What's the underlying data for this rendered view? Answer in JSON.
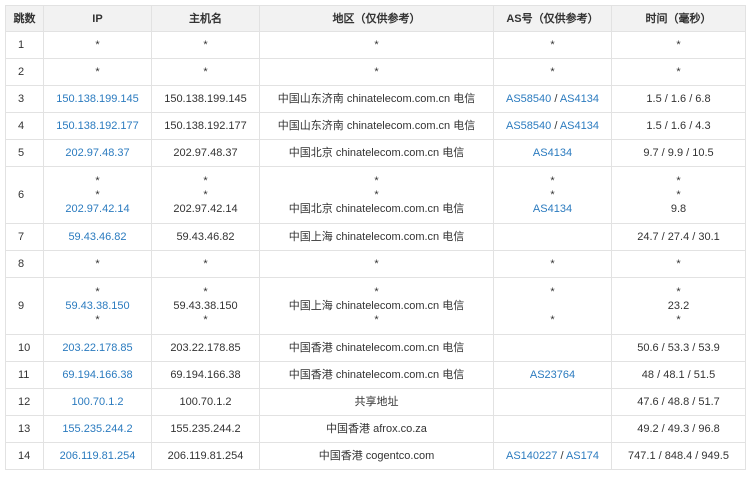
{
  "headers": [
    "跳数",
    "IP",
    "主机名",
    "地区（仅供参考）",
    "AS号（仅供参考）",
    "时间（毫秒）"
  ],
  "rows": [
    {
      "hop": "1",
      "ip": [
        "*"
      ],
      "host": [
        "*"
      ],
      "region": [
        "*"
      ],
      "as": [
        [
          "*"
        ]
      ],
      "time": [
        "*"
      ]
    },
    {
      "hop": "2",
      "ip": [
        "*"
      ],
      "host": [
        "*"
      ],
      "region": [
        "*"
      ],
      "as": [
        [
          "*"
        ]
      ],
      "time": [
        "*"
      ]
    },
    {
      "hop": "3",
      "ip": [
        "150.138.199.145"
      ],
      "host": [
        "150.138.199.145"
      ],
      "region": [
        "中国山东济南 chinatelecom.com.cn 电信"
      ],
      "as": [
        [
          "AS58540",
          "AS4134"
        ]
      ],
      "time": [
        "1.5 / 1.6 / 6.8"
      ]
    },
    {
      "hop": "4",
      "ip": [
        "150.138.192.177"
      ],
      "host": [
        "150.138.192.177"
      ],
      "region": [
        "中国山东济南 chinatelecom.com.cn 电信"
      ],
      "as": [
        [
          "AS58540",
          "AS4134"
        ]
      ],
      "time": [
        "1.5 / 1.6 / 4.3"
      ]
    },
    {
      "hop": "5",
      "ip": [
        "202.97.48.37"
      ],
      "host": [
        "202.97.48.37"
      ],
      "region": [
        "中国北京 chinatelecom.com.cn 电信"
      ],
      "as": [
        [
          "AS4134"
        ]
      ],
      "time": [
        "9.7 / 9.9 / 10.5"
      ]
    },
    {
      "hop": "6",
      "ip": [
        "*",
        "*",
        "202.97.42.14"
      ],
      "host": [
        "*",
        "*",
        "202.97.42.14"
      ],
      "region": [
        "*",
        "*",
        "中国北京 chinatelecom.com.cn 电信"
      ],
      "as": [
        [
          "*"
        ],
        [
          "*"
        ],
        [
          "AS4134"
        ]
      ],
      "time": [
        "*",
        "*",
        "9.8"
      ]
    },
    {
      "hop": "7",
      "ip": [
        "59.43.46.82"
      ],
      "host": [
        "59.43.46.82"
      ],
      "region": [
        "中国上海 chinatelecom.com.cn 电信"
      ],
      "as": [
        []
      ],
      "time": [
        "24.7 / 27.4 / 30.1"
      ]
    },
    {
      "hop": "8",
      "ip": [
        "*"
      ],
      "host": [
        "*"
      ],
      "region": [
        "*"
      ],
      "as": [
        [
          "*"
        ]
      ],
      "time": [
        "*"
      ]
    },
    {
      "hop": "9",
      "ip": [
        "*",
        "59.43.38.150",
        "*"
      ],
      "host": [
        "*",
        "59.43.38.150",
        "*"
      ],
      "region": [
        "*",
        "中国上海 chinatelecom.com.cn 电信",
        "*"
      ],
      "as": [
        [
          "*"
        ],
        [],
        [
          "*"
        ]
      ],
      "time": [
        "*",
        "23.2",
        "*"
      ]
    },
    {
      "hop": "10",
      "ip": [
        "203.22.178.85"
      ],
      "host": [
        "203.22.178.85"
      ],
      "region": [
        "中国香港 chinatelecom.com.cn 电信"
      ],
      "as": [
        []
      ],
      "time": [
        "50.6 / 53.3 / 53.9"
      ]
    },
    {
      "hop": "11",
      "ip": [
        "69.194.166.38"
      ],
      "host": [
        "69.194.166.38"
      ],
      "region": [
        "中国香港 chinatelecom.com.cn 电信"
      ],
      "as": [
        [
          "AS23764"
        ]
      ],
      "time": [
        "48 / 48.1 / 51.5"
      ]
    },
    {
      "hop": "12",
      "ip": [
        "100.70.1.2"
      ],
      "host": [
        "100.70.1.2"
      ],
      "region": [
        "共享地址"
      ],
      "as": [
        []
      ],
      "time": [
        "47.6 / 48.8 / 51.7"
      ]
    },
    {
      "hop": "13",
      "ip": [
        "155.235.244.2"
      ],
      "host": [
        "155.235.244.2"
      ],
      "region": [
        "中国香港 afrox.co.za"
      ],
      "as": [
        []
      ],
      "time": [
        "49.2 / 49.3 / 96.8"
      ]
    },
    {
      "hop": "14",
      "ip": [
        "206.119.81.254"
      ],
      "host": [
        "206.119.81.254"
      ],
      "region": [
        "中国香港 cogentco.com"
      ],
      "as": [
        [
          "AS140227",
          "AS174"
        ]
      ],
      "time": [
        "747.1 / 848.4 / 949.5"
      ]
    }
  ],
  "link_color": "#2b7bbf"
}
